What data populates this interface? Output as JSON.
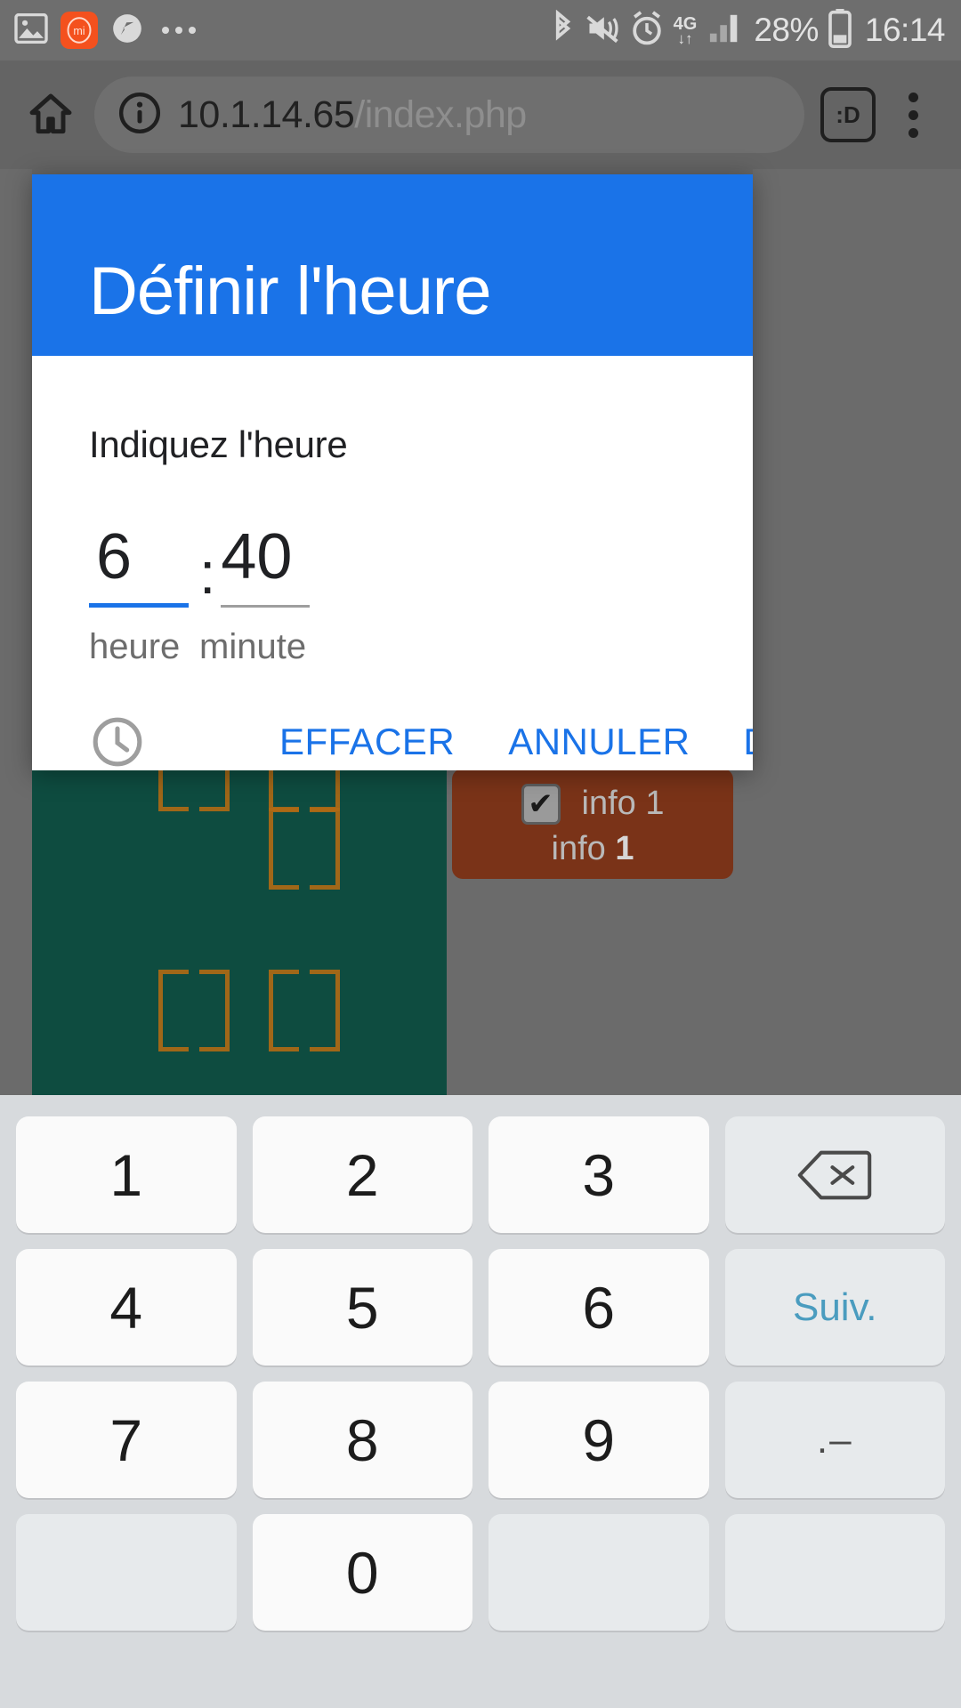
{
  "status_bar": {
    "icons_left": [
      "image-icon",
      "mi-app-icon",
      "navigation-icon",
      "more-notifications-icon"
    ],
    "mi_label": "mi",
    "icons_right": [
      "bluetooth-icon",
      "mute-vibrate-icon",
      "alarm-icon",
      "network-4g-icon",
      "signal-icon"
    ],
    "network_label": "4G",
    "network_arrows": "↓↑",
    "battery_percent": "28%",
    "clock": "16:14"
  },
  "browser": {
    "home_icon": "home-icon",
    "info_icon": "info-icon",
    "url_host": "10.1.14.65",
    "url_path": "/index.php",
    "tab_count": ":D",
    "menu_icon": "overflow-menu-icon"
  },
  "dialog": {
    "title": "Définir l'heure",
    "subtitle": "Indiquez l'heure",
    "header_color": "#1a73e8",
    "accent_color": "#1a73e8",
    "hour_value": "6",
    "minute_value": "40",
    "separator": ":",
    "hour_hint": "heure",
    "minute_hint": "minute",
    "clock_icon": "clock-icon",
    "buttons": {
      "clear": "EFFACER",
      "cancel": "ANNULER",
      "set": "DÉFINIR"
    }
  },
  "page_background": {
    "green_panel_color": "#0e4c40",
    "brown_card_color": "#7a3318",
    "checkbox_icon": "checked-checkbox-icon",
    "checkbox_glyph": "✔",
    "info_label_1": "info 1",
    "info_label_2_prefix": "info ",
    "info_label_2_value": "1"
  },
  "keyboard": {
    "rows": [
      [
        {
          "label": "1",
          "name": "key-1",
          "type": "num"
        },
        {
          "label": "2",
          "name": "key-2",
          "type": "num"
        },
        {
          "label": "3",
          "name": "key-3",
          "type": "num"
        },
        {
          "label": "",
          "name": "key-backspace",
          "type": "fn",
          "icon": "backspace-icon"
        }
      ],
      [
        {
          "label": "4",
          "name": "key-4",
          "type": "num"
        },
        {
          "label": "5",
          "name": "key-5",
          "type": "num"
        },
        {
          "label": "6",
          "name": "key-6",
          "type": "num"
        },
        {
          "label": "Suiv.",
          "name": "key-next",
          "type": "fn"
        }
      ],
      [
        {
          "label": "7",
          "name": "key-7",
          "type": "num"
        },
        {
          "label": "8",
          "name": "key-8",
          "type": "num"
        },
        {
          "label": "9",
          "name": "key-9",
          "type": "num"
        },
        {
          "label": ".–",
          "name": "key-dot-dash",
          "type": "fn"
        }
      ],
      [
        {
          "label": "",
          "name": "key-blank-left",
          "type": "blank"
        },
        {
          "label": "0",
          "name": "key-0",
          "type": "num"
        },
        {
          "label": "",
          "name": "key-blank-mid",
          "type": "blank"
        },
        {
          "label": "",
          "name": "key-blank-right",
          "type": "blank"
        }
      ]
    ],
    "next_label": "Suiv.",
    "dot_dash_label": ".–"
  }
}
